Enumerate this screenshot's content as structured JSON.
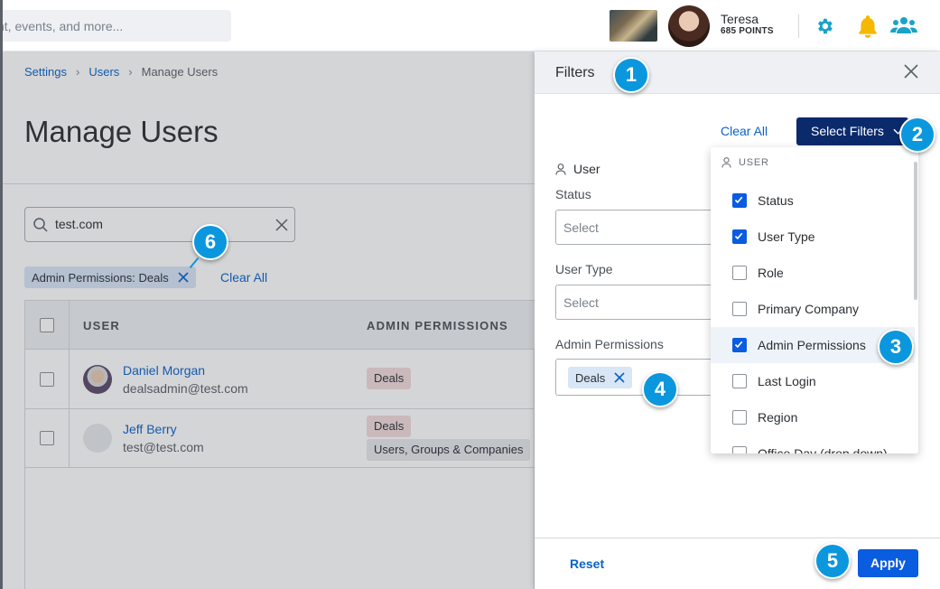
{
  "header": {
    "search_placeholder": "nt, events, and more...",
    "user_name": "Teresa",
    "user_points": "685 POINTS"
  },
  "page": {
    "breadcrumb": [
      "Settings",
      "Users",
      "Manage Users"
    ],
    "title": "Manage Users",
    "search_value": "test.com",
    "active_filter_chip": "Admin Permissions: Deals",
    "clear_all": "Clear All",
    "table": {
      "columns": [
        "USER",
        "ADMIN PERMISSIONS"
      ],
      "rows": [
        {
          "name": "Daniel Morgan",
          "email": "dealsadmin@test.com",
          "permissions": [
            "Deals"
          ]
        },
        {
          "name": "Jeff Berry",
          "email": "test@test.com",
          "permissions": [
            "Deals",
            "Users, Groups & Companies"
          ]
        }
      ]
    }
  },
  "panel": {
    "title": "Filters",
    "clear_all": "Clear All",
    "select_filters": "Select Filters",
    "section_user": "User",
    "status_label": "Status",
    "status_placeholder": "Select",
    "user_type_label": "User Type",
    "user_type_placeholder": "Select",
    "admin_perm_label": "Admin Permissions",
    "admin_perm_chip": "Deals",
    "reset": "Reset",
    "apply": "Apply"
  },
  "dropdown": {
    "section": "USER",
    "items": [
      {
        "label": "Status",
        "checked": true
      },
      {
        "label": "User Type",
        "checked": true
      },
      {
        "label": "Role",
        "checked": false
      },
      {
        "label": "Primary Company",
        "checked": false
      },
      {
        "label": "Admin Permissions",
        "checked": true
      },
      {
        "label": "Last Login",
        "checked": false
      },
      {
        "label": "Region",
        "checked": false
      },
      {
        "label": "Office Day (drop down)",
        "checked": false
      }
    ]
  },
  "badges": [
    "1",
    "2",
    "3",
    "4",
    "5",
    "6"
  ],
  "colors": {
    "accent": "#0a62c9",
    "primary_button": "#0b2a6b",
    "apply_button": "#0a5ce0",
    "badge": "#0b97dd",
    "bell": "#f5b800",
    "icon_teal": "#19a3c9"
  }
}
